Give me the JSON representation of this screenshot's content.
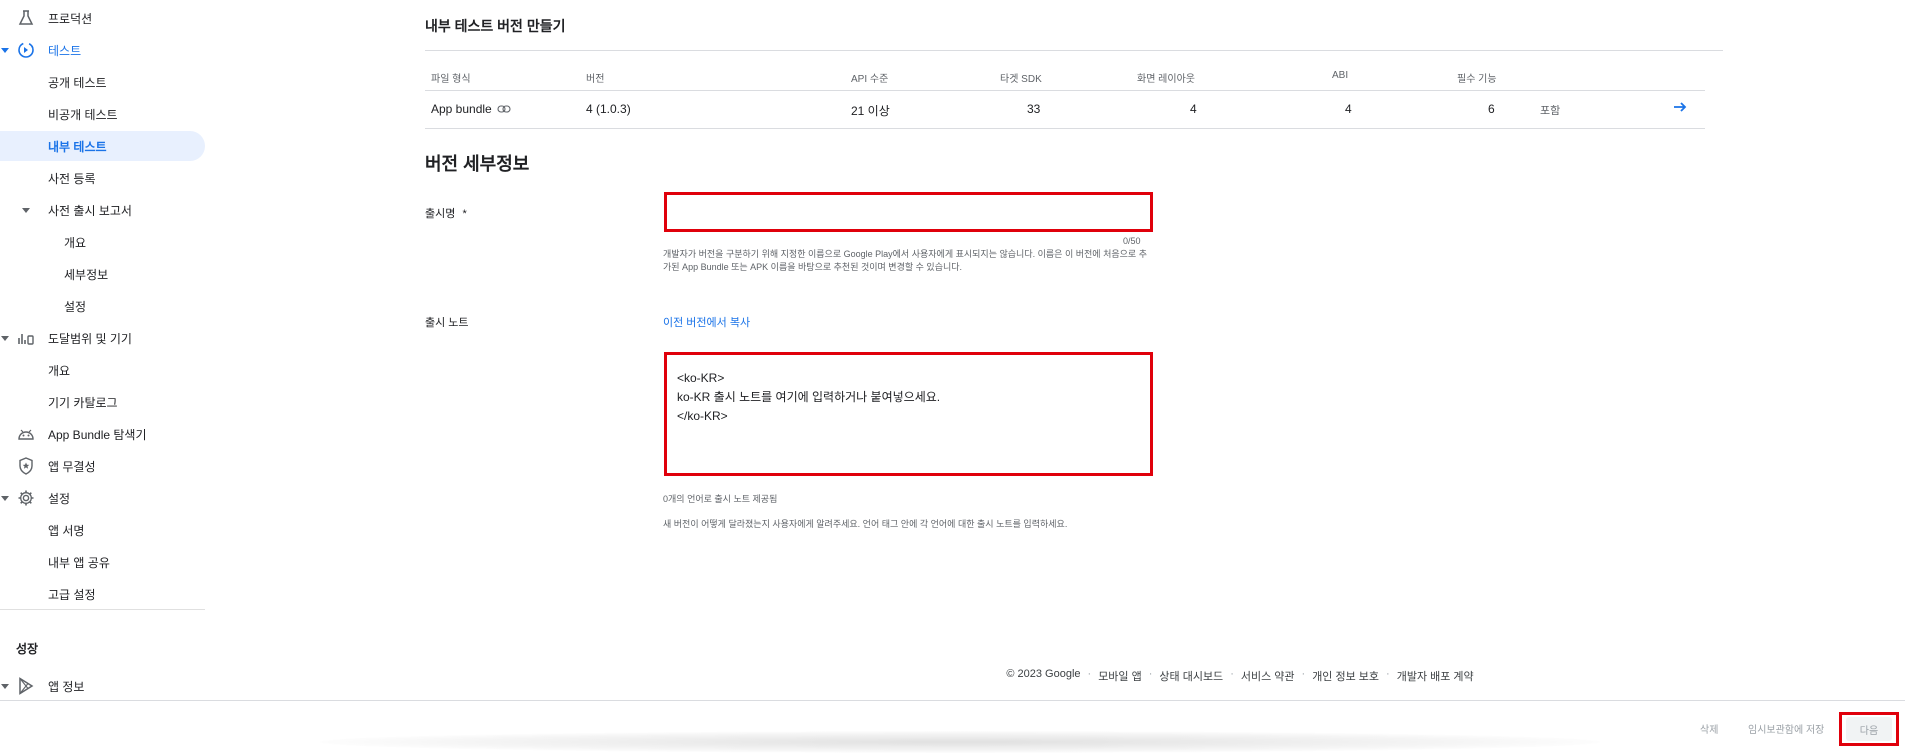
{
  "sidebar": {
    "items": [
      {
        "label": "프로덕션"
      },
      {
        "label": "테스트"
      },
      {
        "label": "공개 테스트"
      },
      {
        "label": "비공개 테스트"
      },
      {
        "label": "내부 테스트"
      },
      {
        "label": "사전 등록"
      },
      {
        "label": "사전 출시 보고서"
      },
      {
        "label": "개요"
      },
      {
        "label": "세부정보"
      },
      {
        "label": "설정"
      },
      {
        "label": "도달범위 및 기기"
      },
      {
        "label": "개요"
      },
      {
        "label": "기기 카탈로그"
      },
      {
        "label": "App Bundle 탐색기"
      },
      {
        "label": "앱 무결성"
      },
      {
        "label": "설정"
      },
      {
        "label": "앱 서명"
      },
      {
        "label": "내부 앱 공유"
      },
      {
        "label": "고급 설정"
      }
    ],
    "section_growth": "성장",
    "app_info": "앱 정보"
  },
  "page": {
    "title": "내부 테스트 버전 만들기"
  },
  "table": {
    "headers": {
      "file_type": "파일 형식",
      "version": "버전",
      "api_level": "API 수준",
      "target_sdk": "타겟 SDK",
      "screen_layout": "화면 레이아웃",
      "abi": "ABI",
      "required_features": "필수 기능"
    },
    "row": {
      "file_type": "App bundle",
      "version": "4 (1.0.3)",
      "api_level": "21 이상",
      "target_sdk": "33",
      "screen_layout": "4",
      "abi": "4",
      "required_features": "6",
      "status": "포함"
    }
  },
  "release": {
    "section_title": "버전 세부정보",
    "name_label": "출시명",
    "required_marker": "*",
    "name_value": "",
    "name_counter": "0/50",
    "name_helper": "개발자가 버전을 구분하기 위해 지정한 이름으로 Google Play에서 사용자에게 표시되지는 않습니다. 이름은 이 버전에 처음으로 추가된 App Bundle 또는 APK 이름을 바탕으로 추천된 것이며 변경할 수 있습니다.",
    "notes_label": "출시 노트",
    "copy_link": "이전 버전에서 복사",
    "notes_value": "<ko-KR>\nko-KR 출시 노트를 여기에 입력하거나 붙여넣으세요.\n</ko-KR>",
    "notes_count": "0개의 언어로 출시 노트 제공됨",
    "notes_hint": "새 버전이 어떻게 달라졌는지 사용자에게 알려주세요. 언어 태그 안에 각 언어에 대한 출시 노트를 입력하세요."
  },
  "footer": {
    "copyright": "© 2023 Google",
    "links": [
      "모바일 앱",
      "상태 대시보드",
      "서비스 약관",
      "개인 정보 보호",
      "개발자 배포 계약"
    ]
  },
  "bottom_bar": {
    "delete": "삭제",
    "save_draft": "임시보관함에 저장",
    "next": "다음"
  },
  "colors": {
    "accent": "#1a73e8",
    "highlight_border": "#e0000b",
    "active_bg": "#e8f0fe"
  }
}
